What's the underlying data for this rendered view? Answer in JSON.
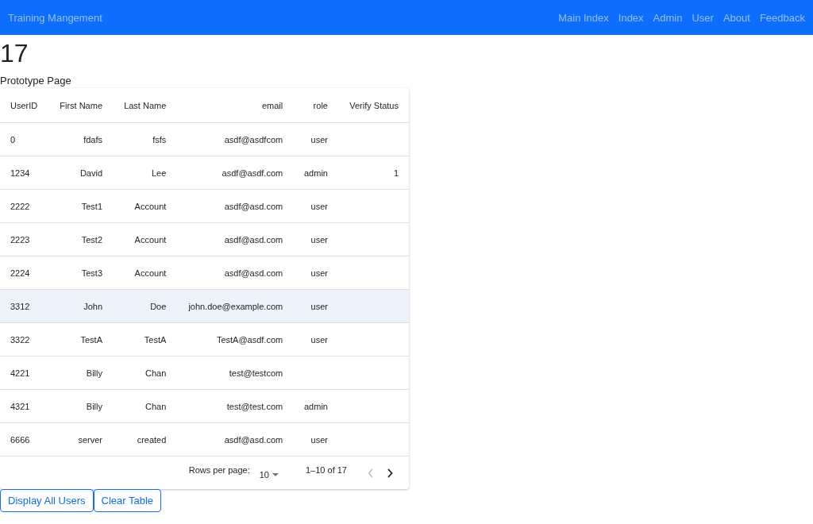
{
  "navbar": {
    "brand": "Training Mangement",
    "links": [
      "Main Index",
      "Index",
      "Admin",
      "User",
      "About",
      "Feedback"
    ]
  },
  "heading": "17",
  "subtitle": "Prototype Page",
  "table": {
    "columns": [
      "UserID",
      "First Name",
      "Last Name",
      "email",
      "role",
      "Verify Status"
    ],
    "rows": [
      {
        "selected": false,
        "cells": [
          "0",
          "fdafs",
          "fsfs",
          "asdf@asdfcom",
          "user",
          ""
        ]
      },
      {
        "selected": false,
        "cells": [
          "1234",
          "David",
          "Lee",
          "asdf@asdf.com",
          "admin",
          "1"
        ]
      },
      {
        "selected": false,
        "cells": [
          "2222",
          "Test1",
          "Account",
          "asdf@asd.com",
          "user",
          ""
        ]
      },
      {
        "selected": false,
        "cells": [
          "2223",
          "Test2",
          "Account",
          "asdf@asd.com",
          "user",
          ""
        ]
      },
      {
        "selected": false,
        "cells": [
          "2224",
          "Test3",
          "Account",
          "asdf@asd.com",
          "user",
          ""
        ]
      },
      {
        "selected": true,
        "cells": [
          "3312",
          "John",
          "Doe",
          "john.doe@example.com",
          "user",
          ""
        ]
      },
      {
        "selected": false,
        "cells": [
          "3322",
          "TestA",
          "TestA",
          "TestA@asdf.com",
          "user",
          ""
        ]
      },
      {
        "selected": false,
        "cells": [
          "4221",
          "Billy",
          "Chan",
          "test@testcom",
          "",
          ""
        ]
      },
      {
        "selected": false,
        "cells": [
          "4321",
          "Billy",
          "Chan",
          "test@test.com",
          "admin",
          ""
        ]
      },
      {
        "selected": false,
        "cells": [
          "6666",
          "server",
          "created",
          "asdf@asd.com",
          "user",
          ""
        ]
      }
    ],
    "pagination": {
      "rows_per_page_label": "Rows per page:",
      "rows_per_page": "10",
      "range": "1–10 of 17",
      "prev_disabled": true,
      "next_disabled": false
    }
  },
  "buttons": [
    "Display All Users",
    "Clear Table"
  ]
}
